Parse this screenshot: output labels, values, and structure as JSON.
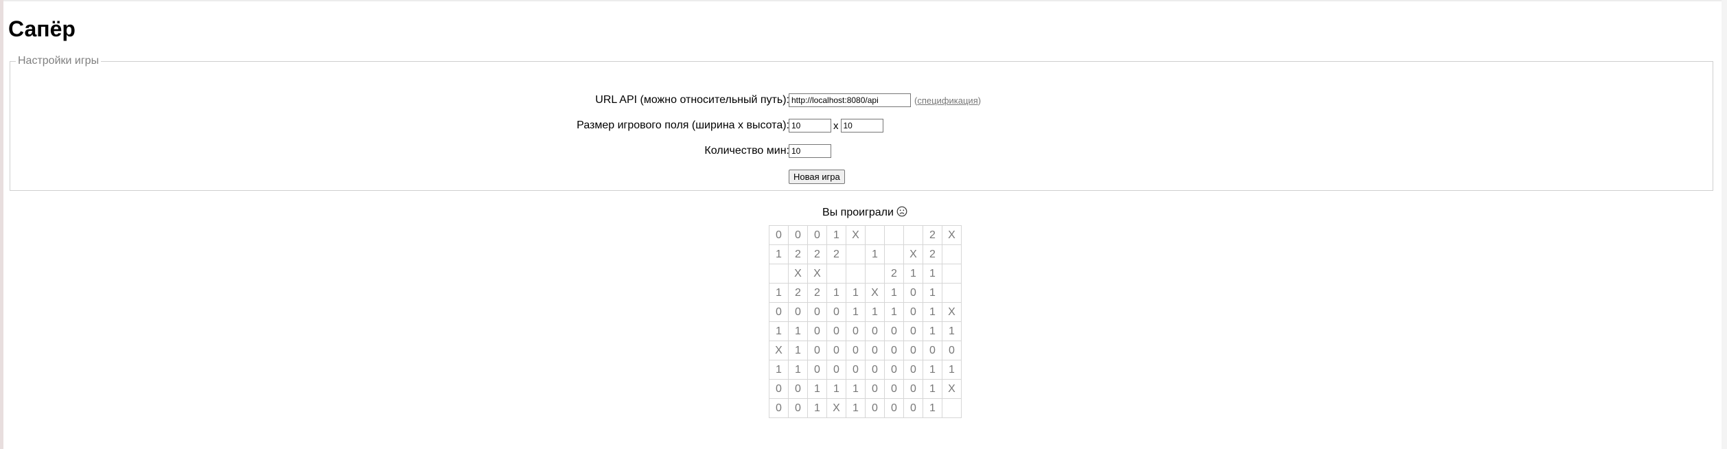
{
  "page": {
    "title": "Сапёр"
  },
  "settings": {
    "legend": "Настройки игры",
    "api_label": "URL API (можно относительный путь):",
    "api_value": "http://localhost:8080/api",
    "spec_open": "(",
    "spec_link": "спецификация",
    "spec_close": ")",
    "size_label": "Размер игрового поля (ширина х высота):",
    "width_value": "10",
    "times": "х",
    "height_value": "10",
    "mines_label": "Количество мин:",
    "mines_value": "10",
    "new_game_label": "Новая игра"
  },
  "status": {
    "text": "Вы проиграли",
    "face_icon": "sad-face-icon"
  },
  "colors": {
    "mine": "#ef0000",
    "one": "#1b18c9",
    "two": "#6e6e6e",
    "zero": "#dcdcdc",
    "hidden": "#f2f2f2"
  },
  "board": [
    [
      "0",
      "0",
      "0",
      "1",
      "X",
      "",
      "",
      "",
      "2",
      "X"
    ],
    [
      "1",
      "2",
      "2",
      "2",
      "",
      "1",
      "",
      "X",
      "2",
      ""
    ],
    [
      "",
      "X",
      "X",
      "",
      "",
      "",
      "2",
      "1",
      "1",
      ""
    ],
    [
      "1",
      "2",
      "2",
      "1",
      "1",
      "X",
      "1",
      "0",
      "1",
      ""
    ],
    [
      "0",
      "0",
      "0",
      "0",
      "1",
      "1",
      "1",
      "0",
      "1",
      "X"
    ],
    [
      "1",
      "1",
      "0",
      "0",
      "0",
      "0",
      "0",
      "0",
      "1",
      "1"
    ],
    [
      "X",
      "1",
      "0",
      "0",
      "0",
      "0",
      "0",
      "0",
      "0",
      "0"
    ],
    [
      "1",
      "1",
      "0",
      "0",
      "0",
      "0",
      "0",
      "0",
      "1",
      "1"
    ],
    [
      "0",
      "0",
      "1",
      "1",
      "1",
      "0",
      "0",
      "0",
      "1",
      "X"
    ],
    [
      "0",
      "0",
      "1",
      "X",
      "1",
      "0",
      "0",
      "0",
      "1",
      ""
    ]
  ]
}
